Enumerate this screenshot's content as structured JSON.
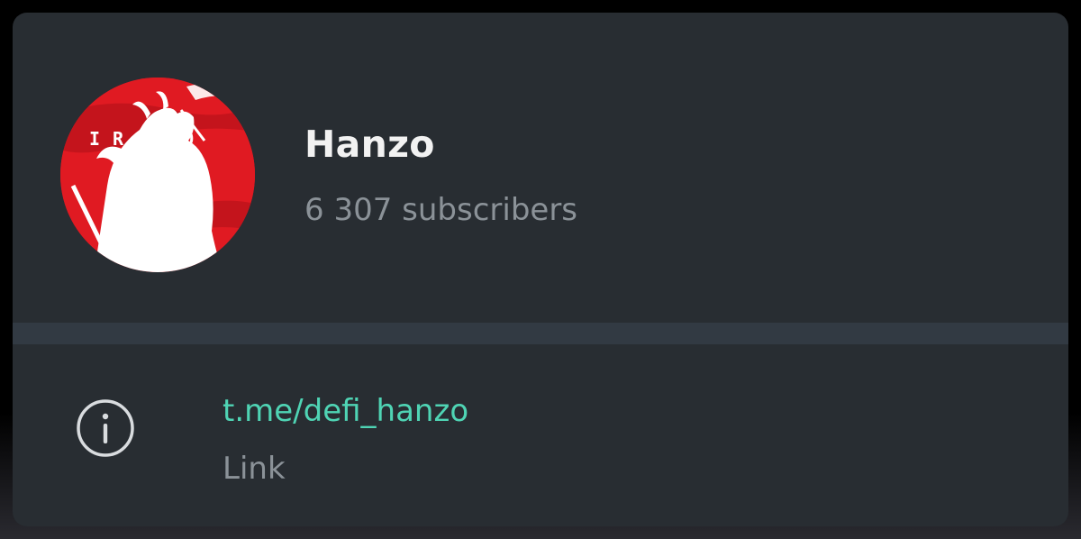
{
  "channel": {
    "name": "Hanzo",
    "subscribers": "6 307 subscribers",
    "avatar_text": "IRDRO",
    "avatar_colors": {
      "background": "#e01a22",
      "figure": "#ffffff"
    }
  },
  "info": {
    "icon": "info-icon",
    "link": "t.me/defi_hanzo",
    "label": "Link"
  },
  "colors": {
    "card_bg": "#282d32",
    "separator": "#323a43",
    "link": "#4fd4b4",
    "secondary_text": "#8b9298",
    "title_text": "#f2f2f2"
  }
}
